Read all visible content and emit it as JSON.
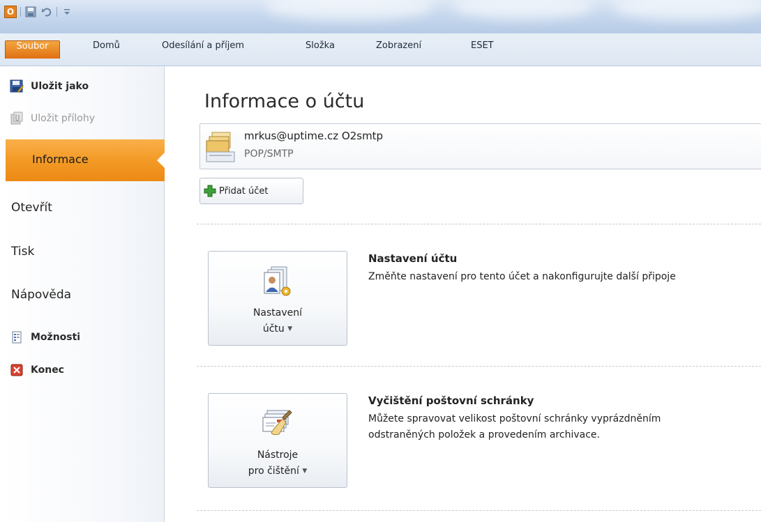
{
  "titlebar": {
    "app_icon_letter": "O",
    "qat": [
      "save-icon",
      "undo-icon",
      "customize-icon"
    ]
  },
  "tabs": [
    "Soubor",
    "Domů",
    "Odesílání a příjem",
    "Složka",
    "Zobrazení",
    "ESET"
  ],
  "leftnav": {
    "save_as": "Uložit jako",
    "save_attachments": "Uložit přílohy",
    "info": "Informace",
    "open": "Otevřít",
    "print": "Tisk",
    "help": "Nápověda",
    "options": "Možnosti",
    "exit": "Konec"
  },
  "main": {
    "title": "Informace o účtu",
    "account": {
      "email": "mrkus@uptime.cz O2smtp",
      "type": "POP/SMTP"
    },
    "add_account": "Přidat účet",
    "settings_section": {
      "button_line1": "Nastavení",
      "button_line2": "účtu",
      "title": "Nastavení účtu",
      "description": "Změňte nastavení pro tento účet a nakonfigurujte další připoje"
    },
    "cleanup_section": {
      "button_line1": "Nástroje",
      "button_line2": "pro čištění",
      "title": "Vyčištění poštovní schránky",
      "description_line1": "Můžete spravovat velikost poštovní schránky vyprázdněním",
      "description_line2": "odstraněných položek a provedením archivace."
    }
  },
  "colors": {
    "file_tab": "#e06f12",
    "active_nav": "#f39a26",
    "ribbon": "#dde7f3"
  }
}
